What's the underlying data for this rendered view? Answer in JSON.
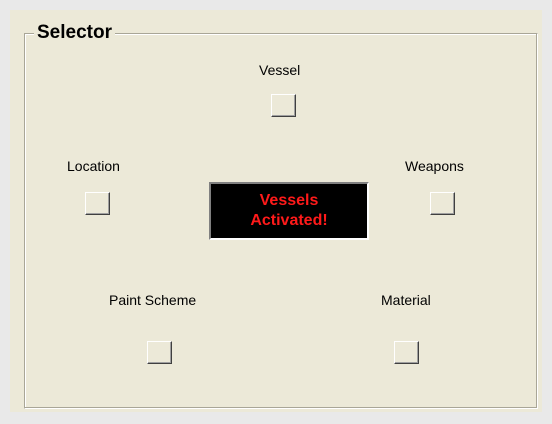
{
  "group": {
    "title": "Selector"
  },
  "options": {
    "vessel": "Vessel",
    "location": "Location",
    "weapons": "Weapons",
    "paint_scheme": "Paint Scheme",
    "material": "Material"
  },
  "status": {
    "text": "Vessels\nActivated!",
    "color": "#ff1a1a",
    "background": "#000000"
  },
  "colors": {
    "panel_background": "#ece9d8",
    "window_background": "#e9e9e9"
  }
}
